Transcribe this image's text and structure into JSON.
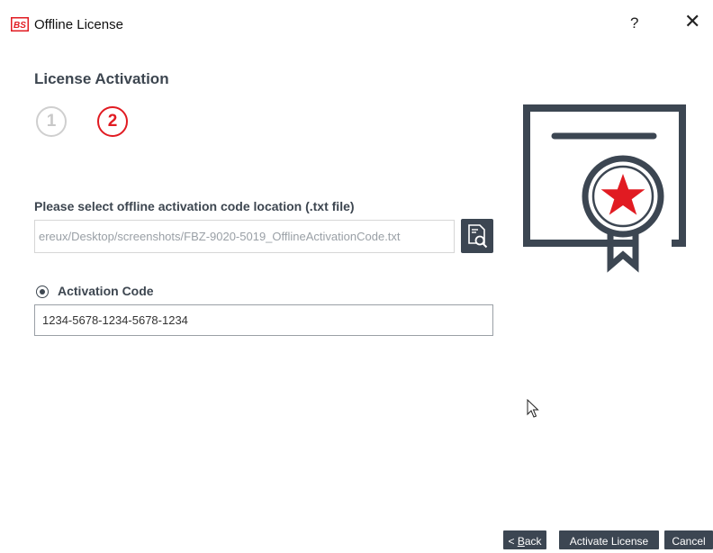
{
  "window": {
    "app_icon": "bs-logo-icon",
    "title": "Offline License",
    "help_label": "?",
    "close_label": "✕"
  },
  "page": {
    "heading": "License Activation",
    "steps": [
      "1",
      "2"
    ],
    "current_step": 2
  },
  "location": {
    "label": "Please select offline activation code location (.txt file)",
    "path_value": "ereux/Desktop/screenshots/FBZ-9020-5019_OfflineActivationCode.txt",
    "browse_icon": "file-search-icon"
  },
  "activation": {
    "label": "Activation Code",
    "selected": true,
    "code_value": "1234-5678-1234-5678-1234"
  },
  "illustration": "certificate-icon",
  "footer": {
    "back_prefix": "< ",
    "back_mnemonic": "B",
    "back_rest": "ack",
    "activate_label": "Activate License",
    "cancel_label": "Cancel"
  },
  "colors": {
    "accent": "#e11b22",
    "dark_button": "#3c4652",
    "muted_step": "#c8c8c8"
  }
}
